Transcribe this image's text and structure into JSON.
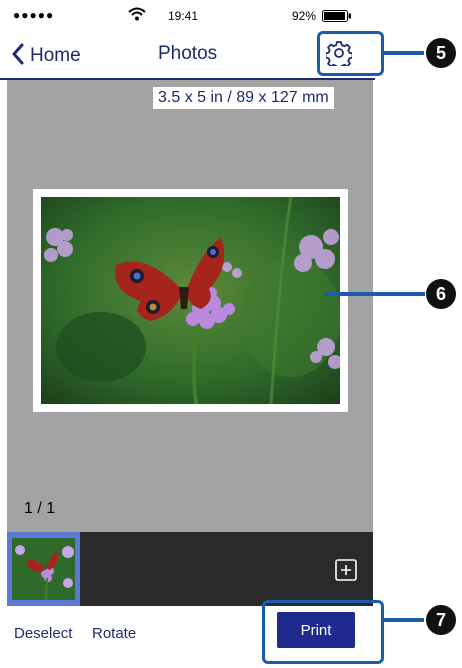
{
  "status_bar": {
    "signal": "●●●●●",
    "time": "19:41",
    "battery": "92%"
  },
  "nav": {
    "back_label": "Home",
    "title": "Photos",
    "settings_icon": "gear-icon"
  },
  "preview": {
    "paper_size": "3.5 x 5 in / 89 x 127 mm",
    "page_counter": "1 / 1"
  },
  "thumbnails": {
    "add_icon": "plus-square-icon"
  },
  "toolbar": {
    "deselect_label": "Deselect",
    "rotate_label": "Rotate",
    "print_label": "Print"
  },
  "callouts": {
    "settings_badge": "5",
    "preview_badge": "6",
    "print_badge": "7",
    "accent_color": "#1b5dab"
  },
  "colors": {
    "nav_text": "#1e2a6e",
    "print_button": "#1e2a8e",
    "preview_bg": "#a3a3a3",
    "thumb_selected": "#5b79d6"
  }
}
